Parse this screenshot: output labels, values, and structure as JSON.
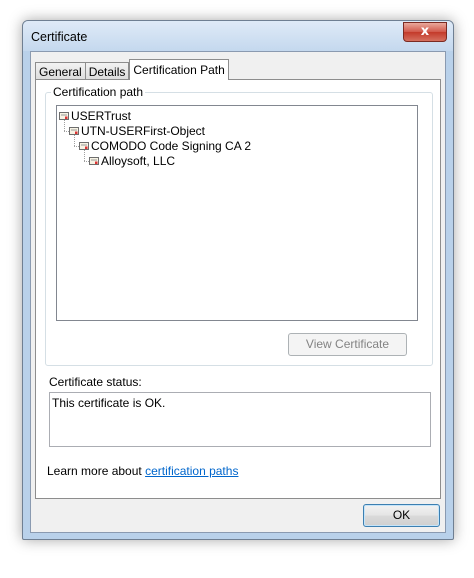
{
  "window": {
    "title": "Certificate",
    "close_symbol": "x"
  },
  "tabs": [
    {
      "label": "General",
      "active": false
    },
    {
      "label": "Details",
      "active": false
    },
    {
      "label": "Certification Path",
      "active": true
    }
  ],
  "certification_path": {
    "group_label": "Certification path",
    "tree": [
      {
        "label": "USERTrust",
        "level": 0,
        "icon": "certificate-icon"
      },
      {
        "label": "UTN-USERFirst-Object",
        "level": 1,
        "icon": "certificate-icon"
      },
      {
        "label": "COMODO Code Signing CA 2",
        "level": 2,
        "icon": "certificate-icon"
      },
      {
        "label": "Alloysoft, LLC",
        "level": 3,
        "icon": "certificate-icon"
      }
    ],
    "view_certificate_label": "View Certificate"
  },
  "status": {
    "label": "Certificate status:",
    "text": "This certificate is OK."
  },
  "learn_more": {
    "prefix": "Learn more about ",
    "link_text": "certification paths"
  },
  "footer": {
    "ok_label": "OK"
  },
  "colors": {
    "link": "#0066cc",
    "close_button": "#c33a2a",
    "ok_border": "#3c7fb1"
  }
}
